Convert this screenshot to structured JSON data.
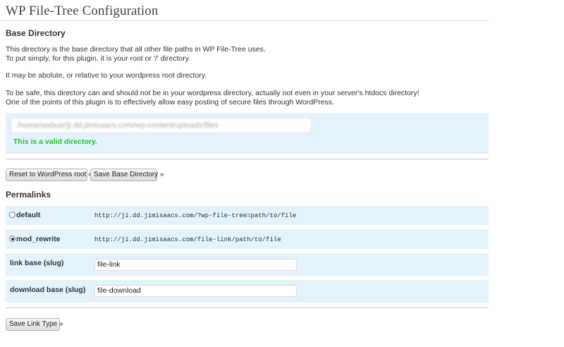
{
  "page": {
    "title": "WP File-Tree Configuration"
  },
  "base_directory": {
    "heading": "Base Directory",
    "desc_line1": "This directory is the base directory that all other file paths in WP File-Tree uses.",
    "desc_line2": "To put simply, for this plugin, it is your root or '/' directory.",
    "desc_line3": "It may be abolute, or relative to your wordpress root directory.",
    "desc_line4": "To be safe, this directory can and should not be in your wordpress directory, actually not even in your server's htdocs directory!",
    "desc_line5": "One of the points of this plugin is to effectively allow easy posting of secure files through WordPress.",
    "path_value": "/home/webusr/ji.dd.jimisaacs.com/wp-content/uploads/files",
    "valid_message": "This is a valid directory.",
    "reset_button": "Reset to WordPress root »",
    "save_button": "Save Base Directory »"
  },
  "permalinks": {
    "heading": "Permalinks",
    "default_label": "default",
    "default_url": "http://ji.dd.jimisaacs.com/?wp-file-tree=path/to/file",
    "mod_rewrite_label": "mod_rewrite",
    "mod_rewrite_url": "http://ji.dd.jimisaacs.com/file-link/path/to/file",
    "selected": "mod_rewrite",
    "link_base_label": "link base (slug)",
    "link_base_value": "file-link",
    "download_base_label": "download base (slug)",
    "download_base_value": "file-download",
    "save_button": "Save Link Type »"
  }
}
